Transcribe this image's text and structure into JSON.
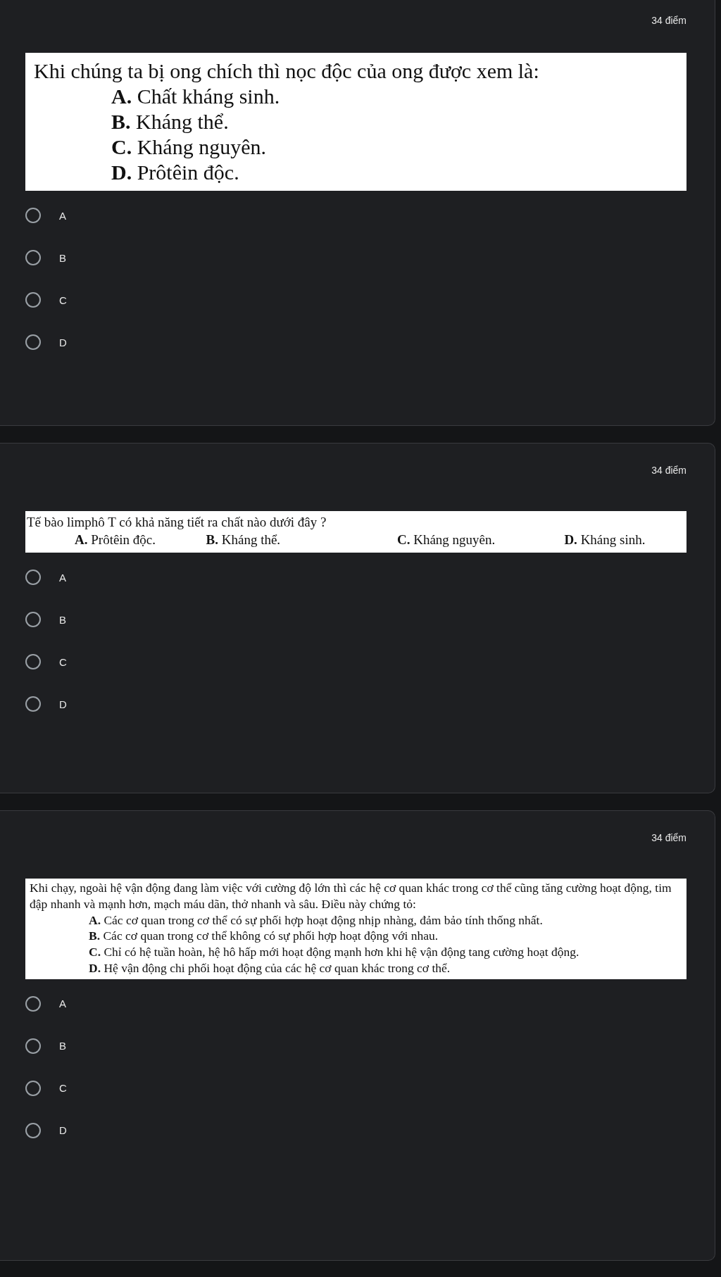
{
  "questions": [
    {
      "points": "34 điểm",
      "kind": "stacked",
      "stem": "Khi chúng ta bị ong chích thì nọc độc của ong được xem là:",
      "options": [
        {
          "label": "A.",
          "text": "Chất kháng sinh."
        },
        {
          "label": "B.",
          "text": "Kháng thể."
        },
        {
          "label": "C.",
          "text": "Kháng nguyên."
        },
        {
          "label": "D.",
          "text": "Prôtêin độc."
        }
      ],
      "choices": [
        {
          "label": "A",
          "selected": false
        },
        {
          "label": "B",
          "selected": false
        },
        {
          "label": "C",
          "selected": false
        },
        {
          "label": "D",
          "selected": false
        }
      ]
    },
    {
      "points": "34 điểm",
      "kind": "row",
      "stem": "Tế bào limphô T có khả năng tiết ra chất nào dưới đây ?",
      "options": [
        {
          "label": "A.",
          "text": "Prôtêin độc."
        },
        {
          "label": "B.",
          "text": "Kháng thể."
        },
        {
          "label": "C.",
          "text": "Kháng nguyên."
        },
        {
          "label": "D.",
          "text": "Kháng sinh."
        }
      ],
      "choices": [
        {
          "label": "A",
          "selected": false
        },
        {
          "label": "B",
          "selected": false
        },
        {
          "label": "C",
          "selected": false
        },
        {
          "label": "D",
          "selected": false
        }
      ]
    },
    {
      "points": "34 điểm",
      "kind": "paragraph",
      "stem": "Khi chạy, ngoài hệ vận động đang làm việc với cường độ lớn thì các hệ cơ quan khác trong cơ thể cũng tăng cường hoạt động, tim đập nhanh và mạnh hơn, mạch máu dãn, thở nhanh và sâu. Điều này chứng tỏ:",
      "options": [
        {
          "label": "A.",
          "text": "Các cơ quan trong cơ thể có sự phối hợp hoạt động nhịp nhàng, đảm bảo tính thống nhất."
        },
        {
          "label": "B.",
          "text": "Các cơ quan trong cơ thể không có sự phối hợp hoạt động với nhau."
        },
        {
          "label": "C.",
          "text": "Chỉ có hệ tuần hoàn, hệ hô hấp mới hoạt động mạnh hơn khi hệ vận động tang cường hoạt động."
        },
        {
          "label": "D.",
          "text": "Hệ vận động chi phối hoạt động của các hệ cơ quan khác trong cơ thể."
        }
      ],
      "choices": [
        {
          "label": "A",
          "selected": false
        },
        {
          "label": "B",
          "selected": false
        },
        {
          "label": "C",
          "selected": false
        },
        {
          "label": "D",
          "selected": false
        }
      ]
    }
  ]
}
